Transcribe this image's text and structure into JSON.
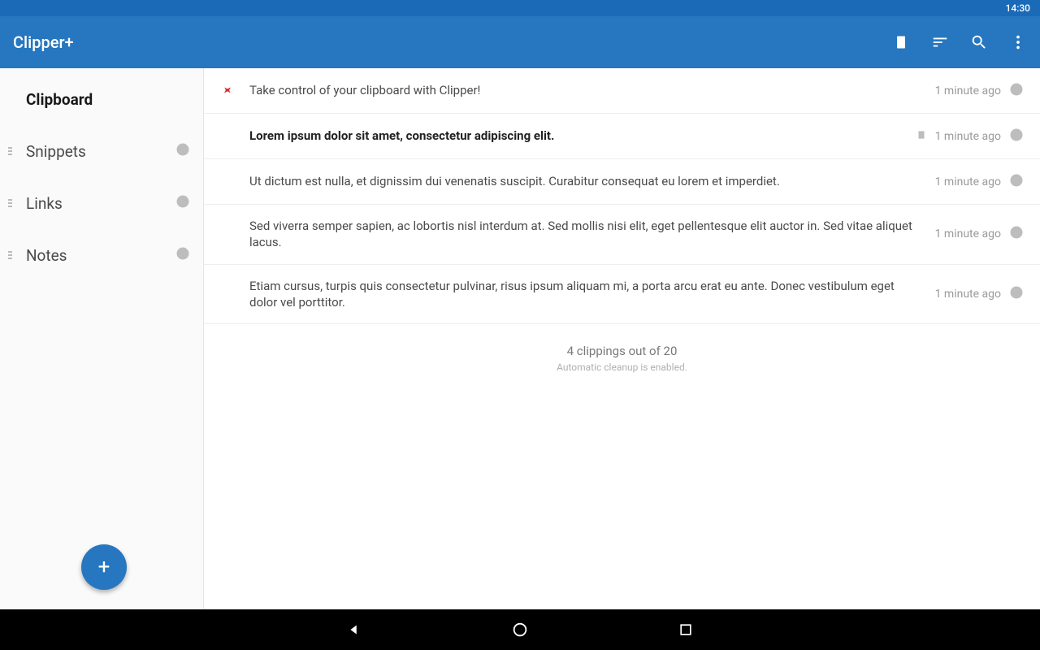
{
  "statusbar": {
    "time": "14:30"
  },
  "appbar": {
    "title": "Clipper+"
  },
  "sidebar": {
    "items": [
      {
        "label": "Clipboard"
      },
      {
        "label": "Snippets"
      },
      {
        "label": "Links"
      },
      {
        "label": "Notes"
      }
    ]
  },
  "clippings": [
    {
      "text": "Take control of your clipboard with Clipper!",
      "time": "1 minute ago"
    },
    {
      "text": "Lorem ipsum dolor sit amet, consectetur adipiscing elit.",
      "time": "1 minute ago"
    },
    {
      "text": "Ut dictum est nulla, et dignissim dui venenatis suscipit. Curabitur consequat eu lorem et imperdiet.",
      "time": "1 minute ago"
    },
    {
      "text": "Sed viverra semper sapien, ac lobortis nisl interdum at. Sed mollis nisi elit, eget pellentesque elit auctor in. Sed vitae aliquet lacus.",
      "time": "1 minute ago"
    },
    {
      "text": "Etiam cursus, turpis quis consectetur pulvinar, risus ipsum aliquam mi, a porta arcu erat eu ante. Donec vestibulum eget dolor vel porttitor.",
      "time": "1 minute ago"
    }
  ],
  "footer": {
    "count": "4 clippings out of 20",
    "cleanup": "Automatic cleanup is enabled."
  }
}
